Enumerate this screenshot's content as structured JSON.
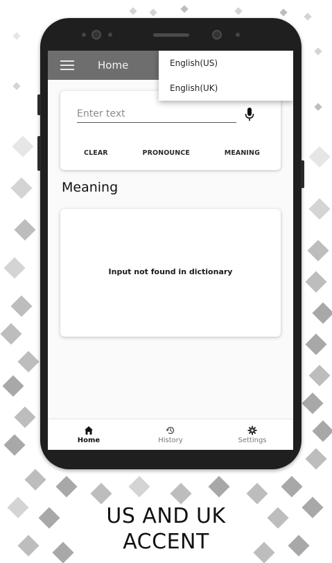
{
  "appbar": {
    "title": "Home"
  },
  "language_menu": {
    "options": [
      "English(US)",
      "English(UK)"
    ]
  },
  "input_card": {
    "placeholder": "Enter text",
    "actions": {
      "clear": "CLEAR",
      "pronounce": "PRONOUNCE",
      "meaning": "MEANING"
    }
  },
  "meaning_section": {
    "title": "Meaning",
    "result_text": "Input not found in dictionary"
  },
  "bottom_nav": {
    "items": [
      {
        "label": "Home",
        "icon": "home-icon",
        "active": true
      },
      {
        "label": "History",
        "icon": "history-icon",
        "active": false
      },
      {
        "label": "Settings",
        "icon": "gear-icon",
        "active": false
      }
    ]
  },
  "caption": {
    "line1": "US AND UK",
    "line2": "ACCENT"
  }
}
